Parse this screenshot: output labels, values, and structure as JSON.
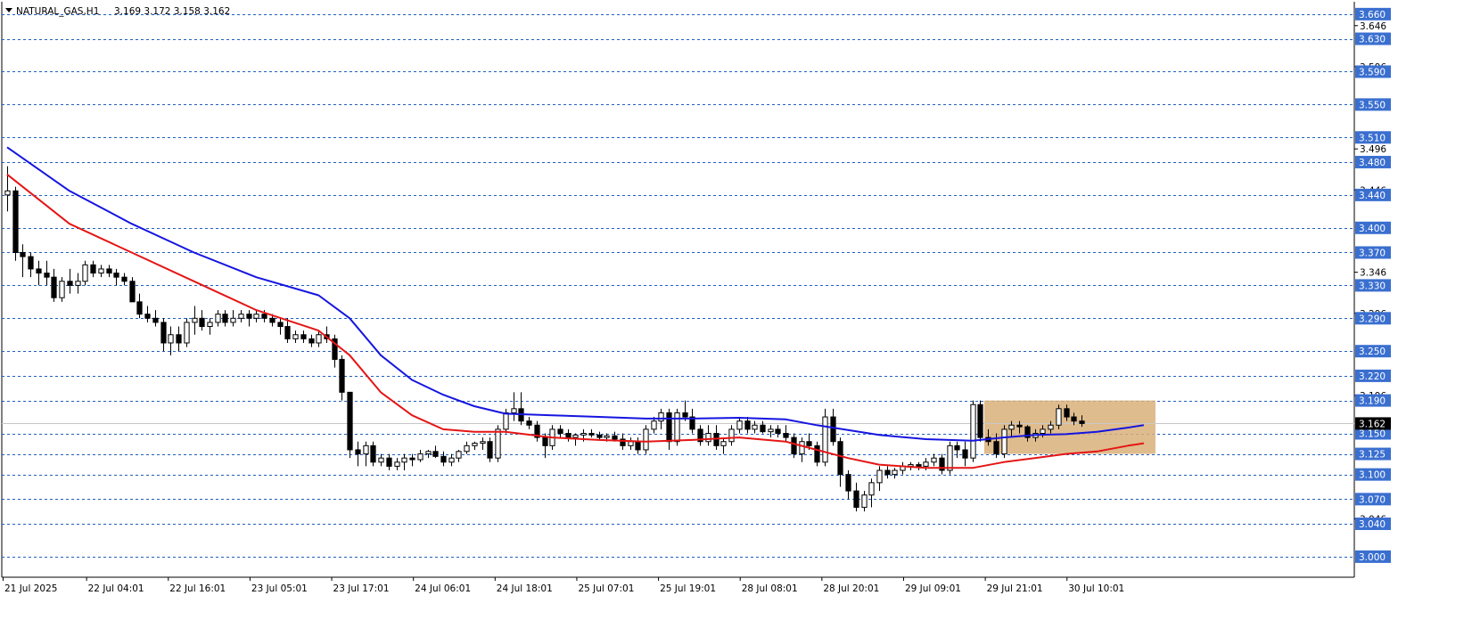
{
  "header": {
    "symbol_label": "NATURAL_GAS,H1",
    "ohlc": "3.169 3.172 3.158 3.162"
  },
  "colors": {
    "grid": "#1f5fbf",
    "candle": "#000000",
    "ma_fast": "#1515e0",
    "ma_slow": "#e51515",
    "highlight_box": "#d9b07a",
    "price_line": "#c8c8c8",
    "level_badge": "#3a6fd0",
    "price_badge": "#000000"
  },
  "chart_data": {
    "type": "candlestick",
    "symbol": "NATURAL_GAS",
    "timeframe": "H1",
    "ylim": [
      2.975,
      3.675
    ],
    "horizontal_levels": [
      3.66,
      3.63,
      3.59,
      3.55,
      3.51,
      3.48,
      3.44,
      3.4,
      3.37,
      3.33,
      3.29,
      3.25,
      3.22,
      3.19,
      3.15,
      3.125,
      3.1,
      3.07,
      3.04,
      3.0
    ],
    "level_labels": [
      "3.660",
      "3.630",
      "3.590",
      "3.550",
      "3.510",
      "3.480",
      "3.440",
      "3.400",
      "3.370",
      "3.330",
      "3.290",
      "3.250",
      "3.220",
      "3.190",
      "3.150",
      "3.125",
      "3.100",
      "3.070",
      "3.040",
      "3.000"
    ],
    "scale_ticks": [
      3.646,
      3.596,
      3.496,
      3.446,
      3.346,
      3.296,
      3.196,
      3.046
    ],
    "scale_tick_labels": [
      "3.646",
      "3.596",
      "3.496",
      "3.446",
      "3.346",
      "3.296",
      "3.196",
      "3.046"
    ],
    "current_price": 3.162,
    "current_price_label": "3.162",
    "x_labels": [
      "21 Jul 2025",
      "22 Jul 04:01",
      "22 Jul 16:01",
      "23 Jul 05:01",
      "23 Jul 17:01",
      "24 Jul 06:01",
      "24 Jul 18:01",
      "25 Jul 07:01",
      "25 Jul 19:01",
      "28 Jul 08:01",
      "28 Jul 20:01",
      "29 Jul 09:01",
      "29 Jul 21:01",
      "30 Jul 10:01"
    ],
    "highlight_zone": {
      "from_bar": 126,
      "to_bar": 147,
      "price_low": 3.125,
      "price_high": 3.19
    },
    "candles": [
      [
        3.44,
        3.475,
        3.42,
        3.445
      ],
      [
        3.445,
        3.45,
        3.36,
        3.37
      ],
      [
        3.37,
        3.38,
        3.34,
        3.365
      ],
      [
        3.365,
        3.37,
        3.34,
        3.35
      ],
      [
        3.35,
        3.36,
        3.33,
        3.345
      ],
      [
        3.345,
        3.36,
        3.33,
        3.34
      ],
      [
        3.34,
        3.35,
        3.31,
        3.315
      ],
      [
        3.315,
        3.34,
        3.31,
        3.335
      ],
      [
        3.335,
        3.35,
        3.32,
        3.33
      ],
      [
        3.33,
        3.345,
        3.32,
        3.335
      ],
      [
        3.335,
        3.36,
        3.33,
        3.355
      ],
      [
        3.355,
        3.36,
        3.34,
        3.345
      ],
      [
        3.345,
        3.355,
        3.34,
        3.35
      ],
      [
        3.35,
        3.355,
        3.34,
        3.345
      ],
      [
        3.345,
        3.35,
        3.33,
        3.34
      ],
      [
        3.34,
        3.345,
        3.33,
        3.335
      ],
      [
        3.335,
        3.34,
        3.31,
        3.31
      ],
      [
        3.31,
        3.32,
        3.29,
        3.295
      ],
      [
        3.295,
        3.305,
        3.285,
        3.29
      ],
      [
        3.29,
        3.3,
        3.28,
        3.285
      ],
      [
        3.285,
        3.29,
        3.25,
        3.26
      ],
      [
        3.26,
        3.28,
        3.245,
        3.27
      ],
      [
        3.27,
        3.28,
        3.25,
        3.26
      ],
      [
        3.26,
        3.29,
        3.255,
        3.285
      ],
      [
        3.285,
        3.305,
        3.27,
        3.29
      ],
      [
        3.29,
        3.3,
        3.275,
        3.28
      ],
      [
        3.28,
        3.29,
        3.27,
        3.285
      ],
      [
        3.285,
        3.3,
        3.28,
        3.295
      ],
      [
        3.295,
        3.3,
        3.28,
        3.285
      ],
      [
        3.285,
        3.3,
        3.28,
        3.29
      ],
      [
        3.29,
        3.3,
        3.285,
        3.295
      ],
      [
        3.295,
        3.3,
        3.28,
        3.29
      ],
      [
        3.29,
        3.3,
        3.285,
        3.295
      ],
      [
        3.295,
        3.3,
        3.285,
        3.29
      ],
      [
        3.29,
        3.295,
        3.28,
        3.285
      ],
      [
        3.285,
        3.29,
        3.27,
        3.28
      ],
      [
        3.28,
        3.29,
        3.26,
        3.265
      ],
      [
        3.265,
        3.275,
        3.26,
        3.27
      ],
      [
        3.27,
        3.275,
        3.26,
        3.265
      ],
      [
        3.265,
        3.27,
        3.255,
        3.26
      ],
      [
        3.26,
        3.275,
        3.255,
        3.27
      ],
      [
        3.27,
        3.28,
        3.26,
        3.265
      ],
      [
        3.265,
        3.27,
        3.23,
        3.24
      ],
      [
        3.24,
        3.245,
        3.19,
        3.2
      ],
      [
        3.2,
        3.2,
        3.12,
        3.13
      ],
      [
        3.13,
        3.14,
        3.11,
        3.125
      ],
      [
        3.125,
        3.14,
        3.11,
        3.135
      ],
      [
        3.135,
        3.14,
        3.11,
        3.115
      ],
      [
        3.115,
        3.125,
        3.11,
        3.12
      ],
      [
        3.12,
        3.125,
        3.105,
        3.11
      ],
      [
        3.11,
        3.12,
        3.105,
        3.115
      ],
      [
        3.115,
        3.125,
        3.105,
        3.12
      ],
      [
        3.12,
        3.125,
        3.11,
        3.118
      ],
      [
        3.118,
        3.13,
        3.115,
        3.125
      ],
      [
        3.125,
        3.13,
        3.12,
        3.128
      ],
      [
        3.128,
        3.135,
        3.12,
        3.122
      ],
      [
        3.122,
        3.128,
        3.11,
        3.115
      ],
      [
        3.115,
        3.125,
        3.11,
        3.12
      ],
      [
        3.12,
        3.13,
        3.115,
        3.128
      ],
      [
        3.128,
        3.14,
        3.125,
        3.135
      ],
      [
        3.135,
        3.14,
        3.13,
        3.138
      ],
      [
        3.138,
        3.145,
        3.13,
        3.14
      ],
      [
        3.14,
        3.145,
        3.115,
        3.12
      ],
      [
        3.12,
        3.16,
        3.115,
        3.155
      ],
      [
        3.155,
        3.18,
        3.15,
        3.175
      ],
      [
        3.175,
        3.2,
        3.165,
        3.18
      ],
      [
        3.18,
        3.2,
        3.16,
        3.165
      ],
      [
        3.165,
        3.17,
        3.155,
        3.16
      ],
      [
        3.16,
        3.165,
        3.14,
        3.145
      ],
      [
        3.145,
        3.15,
        3.12,
        3.135
      ],
      [
        3.135,
        3.16,
        3.13,
        3.155
      ],
      [
        3.155,
        3.16,
        3.145,
        3.15
      ],
      [
        3.15,
        3.155,
        3.14,
        3.145
      ],
      [
        3.145,
        3.15,
        3.135,
        3.148
      ],
      [
        3.148,
        3.155,
        3.14,
        3.15
      ],
      [
        3.15,
        3.155,
        3.145,
        3.148
      ],
      [
        3.148,
        3.152,
        3.142,
        3.145
      ],
      [
        3.145,
        3.15,
        3.14,
        3.147
      ],
      [
        3.147,
        3.152,
        3.14,
        3.143
      ],
      [
        3.143,
        3.15,
        3.13,
        3.135
      ],
      [
        3.135,
        3.145,
        3.13,
        3.14
      ],
      [
        3.14,
        3.145,
        3.125,
        3.13
      ],
      [
        3.13,
        3.16,
        3.125,
        3.155
      ],
      [
        3.155,
        3.17,
        3.15,
        3.165
      ],
      [
        3.165,
        3.18,
        3.155,
        3.175
      ],
      [
        3.175,
        3.18,
        3.13,
        3.14
      ],
      [
        3.14,
        3.18,
        3.135,
        3.175
      ],
      [
        3.175,
        3.19,
        3.165,
        3.17
      ],
      [
        3.17,
        3.18,
        3.15,
        3.155
      ],
      [
        3.155,
        3.16,
        3.135,
        3.14
      ],
      [
        3.14,
        3.16,
        3.135,
        3.15
      ],
      [
        3.15,
        3.16,
        3.13,
        3.135
      ],
      [
        3.135,
        3.145,
        3.125,
        3.14
      ],
      [
        3.14,
        3.16,
        3.135,
        3.155
      ],
      [
        3.155,
        3.17,
        3.15,
        3.165
      ],
      [
        3.165,
        3.17,
        3.15,
        3.155
      ],
      [
        3.155,
        3.165,
        3.15,
        3.16
      ],
      [
        3.16,
        3.165,
        3.15,
        3.152
      ],
      [
        3.152,
        3.16,
        3.145,
        3.155
      ],
      [
        3.155,
        3.16,
        3.145,
        3.15
      ],
      [
        3.15,
        3.16,
        3.14,
        3.145
      ],
      [
        3.145,
        3.15,
        3.12,
        3.125
      ],
      [
        3.125,
        3.145,
        3.115,
        3.14
      ],
      [
        3.14,
        3.15,
        3.13,
        3.135
      ],
      [
        3.135,
        3.14,
        3.11,
        3.115
      ],
      [
        3.115,
        3.18,
        3.11,
        3.17
      ],
      [
        3.17,
        3.18,
        3.135,
        3.14
      ],
      [
        3.14,
        3.145,
        3.085,
        3.1
      ],
      [
        3.1,
        3.105,
        3.07,
        3.08
      ],
      [
        3.08,
        3.09,
        3.055,
        3.06
      ],
      [
        3.06,
        3.08,
        3.055,
        3.075
      ],
      [
        3.075,
        3.095,
        3.06,
        3.09
      ],
      [
        3.09,
        3.11,
        3.08,
        3.105
      ],
      [
        3.105,
        3.11,
        3.095,
        3.1
      ],
      [
        3.1,
        3.108,
        3.095,
        3.105
      ],
      [
        3.105,
        3.115,
        3.1,
        3.11
      ],
      [
        3.11,
        3.115,
        3.105,
        3.112
      ],
      [
        3.112,
        3.115,
        3.105,
        3.11
      ],
      [
        3.11,
        3.12,
        3.105,
        3.115
      ],
      [
        3.115,
        3.125,
        3.11,
        3.12
      ],
      [
        3.12,
        3.125,
        3.1,
        3.105
      ],
      [
        3.105,
        3.14,
        3.1,
        3.135
      ],
      [
        3.135,
        3.14,
        3.12,
        3.13
      ],
      [
        3.13,
        3.14,
        3.11,
        3.12
      ],
      [
        3.12,
        3.19,
        3.115,
        3.185
      ],
      [
        3.185,
        3.19,
        3.14,
        3.145
      ],
      [
        3.145,
        3.155,
        3.135,
        3.14
      ],
      [
        3.14,
        3.15,
        3.12,
        3.125
      ],
      [
        3.125,
        3.16,
        3.12,
        3.155
      ],
      [
        3.155,
        3.165,
        3.145,
        3.16
      ],
      [
        3.16,
        3.165,
        3.15,
        3.158
      ],
      [
        3.158,
        3.16,
        3.14,
        3.145
      ],
      [
        3.145,
        3.155,
        3.14,
        3.15
      ],
      [
        3.15,
        3.16,
        3.145,
        3.155
      ],
      [
        3.155,
        3.165,
        3.15,
        3.16
      ],
      [
        3.16,
        3.185,
        3.155,
        3.18
      ],
      [
        3.18,
        3.185,
        3.165,
        3.17
      ],
      [
        3.17,
        3.175,
        3.16,
        3.165
      ],
      [
        3.165,
        3.172,
        3.158,
        3.162
      ]
    ],
    "ma_fast": [
      [
        0,
        3.498
      ],
      [
        8,
        3.445
      ],
      [
        16,
        3.405
      ],
      [
        24,
        3.37
      ],
      [
        32,
        3.34
      ],
      [
        40,
        3.318
      ],
      [
        44,
        3.29
      ],
      [
        48,
        3.245
      ],
      [
        52,
        3.215
      ],
      [
        56,
        3.197
      ],
      [
        60,
        3.183
      ],
      [
        64,
        3.174
      ],
      [
        70,
        3.172
      ],
      [
        76,
        3.17
      ],
      [
        82,
        3.168
      ],
      [
        88,
        3.168
      ],
      [
        94,
        3.169
      ],
      [
        100,
        3.167
      ],
      [
        104,
        3.16
      ],
      [
        108,
        3.154
      ],
      [
        112,
        3.148
      ],
      [
        118,
        3.143
      ],
      [
        124,
        3.141
      ],
      [
        128,
        3.145
      ],
      [
        132,
        3.148
      ],
      [
        136,
        3.149
      ],
      [
        140,
        3.152
      ],
      [
        144,
        3.157
      ],
      [
        146,
        3.16
      ]
    ],
    "ma_slow": [
      [
        0,
        3.465
      ],
      [
        8,
        3.405
      ],
      [
        16,
        3.37
      ],
      [
        24,
        3.335
      ],
      [
        32,
        3.3
      ],
      [
        40,
        3.275
      ],
      [
        44,
        3.245
      ],
      [
        48,
        3.2
      ],
      [
        52,
        3.172
      ],
      [
        56,
        3.155
      ],
      [
        60,
        3.152
      ],
      [
        64,
        3.152
      ],
      [
        70,
        3.145
      ],
      [
        76,
        3.142
      ],
      [
        82,
        3.14
      ],
      [
        88,
        3.142
      ],
      [
        94,
        3.145
      ],
      [
        100,
        3.14
      ],
      [
        104,
        3.13
      ],
      [
        108,
        3.12
      ],
      [
        112,
        3.112
      ],
      [
        118,
        3.108
      ],
      [
        124,
        3.108
      ],
      [
        128,
        3.115
      ],
      [
        132,
        3.12
      ],
      [
        136,
        3.125
      ],
      [
        140,
        3.128
      ],
      [
        144,
        3.135
      ],
      [
        146,
        3.138
      ]
    ]
  }
}
